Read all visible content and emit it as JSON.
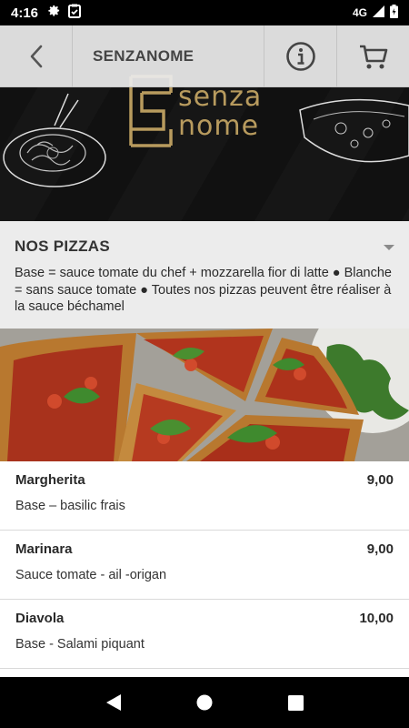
{
  "status_bar": {
    "time": "4:16",
    "network": "4G",
    "icons": [
      "settings-icon",
      "clipboard-icon",
      "signal-icon",
      "battery-icon"
    ]
  },
  "toolbar": {
    "title": "SENZANOME",
    "back_icon": "chevron-left-icon",
    "info_icon": "info-icon",
    "cart_icon": "cart-icon"
  },
  "logo": {
    "line1": "senza",
    "line2": "nome",
    "color": "#b89b5e"
  },
  "section": {
    "title": "NOS PIZZAS",
    "description": "Base = sauce tomate du chef + mozzarella fior di latte ● Blanche = sans sauce tomate ● Toutes nos pizzas peuvent être réaliser à la sauce béchamel"
  },
  "menu": {
    "items": [
      {
        "name": "Margherita",
        "price": "9,00",
        "description": "Base – basilic frais"
      },
      {
        "name": "Marinara",
        "price": "9,00",
        "description": "Sauce tomate - ail -origan"
      },
      {
        "name": "Diavola",
        "price": "10,00",
        "description": "Base - Salami piquant"
      }
    ]
  },
  "nav_bar": {
    "icons": [
      "back-triangle-icon",
      "home-circle-icon",
      "recents-square-icon"
    ]
  }
}
